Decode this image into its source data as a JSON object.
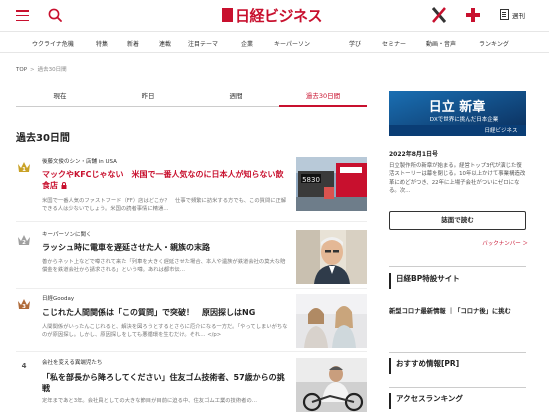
{
  "header": {
    "logo_text": "日経ビジネス",
    "weekly_label": "週刊"
  },
  "nav": {
    "items": [
      "ウクライナ危機",
      "特集",
      "新着",
      "連載",
      "注目テーマ",
      "企業",
      "キーパーソン",
      "学び",
      "セミナー",
      "動画・音声",
      "ランキング"
    ]
  },
  "breadcrumb": {
    "home": "TOP",
    "separator": ">",
    "current": "過去30日間"
  },
  "tabs": [
    "現在",
    "昨日",
    "週間",
    "過去30日間"
  ],
  "active_tab": "過去30日間",
  "section_title": "過去30日間",
  "ranking": [
    {
      "rank": "1",
      "category": "後藤文俊のシン・店舗 in USA",
      "title_prefix": "マックやKFCじゃない　米国で一番人気なのに日本人が知らない飲食店",
      "desc": "米国で一番人気のファストフード（FF）店はどこか？　仕事で頻繁に訪米する方でも、この質問に正解できる人は少ないでしょう。米国の読者事情に精通…",
      "locked": true
    },
    {
      "rank": "2",
      "category": "キーパーソンに聞く",
      "title_prefix": "ラッシュ時に電車を遅延させた人・親族の末路",
      "desc": "善からネット上などで噂されて来た「列車を大きく遅延させた場合、本人や遺族が鉄道会社の莫大な賠償金を鉄道会社から請求される」という噂。あれは都市伝…",
      "locked": false
    },
    {
      "rank": "3",
      "category": "日経Gooday",
      "title_prefix": "こじれた人間関係は「この質問」で突破！　原因探しはNG",
      "desc": "人間関係がいったんこじれると、解決を図ろうとするとさらに厄介になる一方だ。「やってしまいがちなのが原因探し。しかし、原因探しをしても悪循環を生むだけ。それ… </p>",
      "locked": false
    },
    {
      "rank": "4",
      "category": "会社を変える異端児たち",
      "title_prefix": "「私を部長から降ろしてください」住友ゴム技術者、57歳からの挑戦",
      "desc": "定年まであと3年。会社員としての大きな節目が目前に迫る中、住友ゴム工業の技術者の…",
      "locked": false
    }
  ],
  "sidebar": {
    "ad_title": "日立 新章",
    "ad_sub": "DXで世界に挑んだ日本企業",
    "ad_brand": "日経ビジネス",
    "issue_date": "2022年8月1日号",
    "issue_text": "日立製作所の新章が始まる。経営トップ3代が演じた復活ストーリーは幕を閉じる。10年以上かけて事業構造改革にめどがつき、22年に上場子会社がついにゼロになる。次…",
    "read_button": "誌面で読む",
    "back_number": "バックナンバー ＞",
    "bp_head": "日経BP特設サイト",
    "bp_link": "新型コロナ最新情報 ｜「コロナ後」に挑む",
    "recommend_head": "おすすめ情報[PR]",
    "access_head": "アクセスランキング"
  },
  "colors": {
    "brand": "#c8102e",
    "gold": "#c9a227",
    "silver": "#a0a0a0",
    "bronze": "#b06b3a"
  }
}
